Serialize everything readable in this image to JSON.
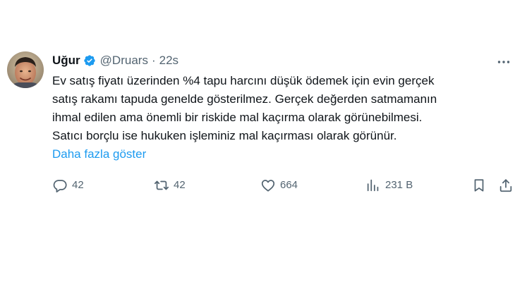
{
  "user": {
    "display_name": "Uğur",
    "handle": "@Druars",
    "separator": "·",
    "time": "22s"
  },
  "tweet": {
    "lines": [
      "Ev satış fiyatı üzerinden %4 tapu harcını düşük ödemek için evin gerçek",
      "satış rakamı tapuda genelde gösterilmez. Gerçek değerden satmamanın",
      "ihmal edilen ama önemli bir riskide mal kaçırma olarak görünebilmesi.",
      "Satıcı borçlu ise hukuken işleminiz mal kaçırması olarak görünür."
    ],
    "show_more": "Daha fazla göster"
  },
  "actions": {
    "reply": {
      "icon": "reply-icon",
      "count": "42"
    },
    "retweet": {
      "icon": "retweet-icon",
      "count": "42"
    },
    "like": {
      "icon": "heart-icon",
      "count": "664"
    },
    "views": {
      "icon": "views-chart-icon",
      "count": "231 B"
    },
    "bookmark": {
      "icon": "bookmark-icon"
    },
    "share": {
      "icon": "share-icon"
    }
  },
  "colors": {
    "text": "#0f1419",
    "secondary": "#536471",
    "link": "#1d9bf0",
    "verified": "#1d9bf0"
  }
}
